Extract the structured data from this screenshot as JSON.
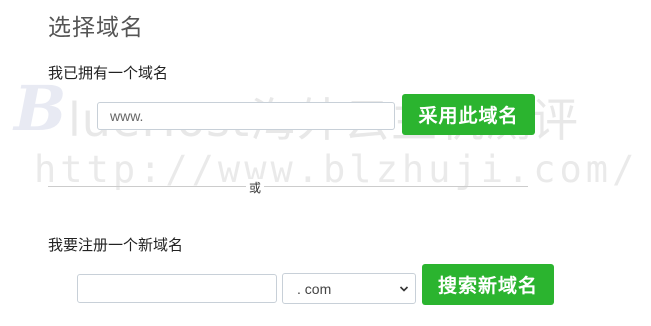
{
  "page": {
    "title": "选择域名"
  },
  "existing_domain": {
    "label": "我已拥有一个域名",
    "input_placeholder": "www.",
    "input_value": "",
    "button_label": "采用此域名"
  },
  "divider": {
    "or_text": "或"
  },
  "new_domain": {
    "label": "我要注册一个新域名",
    "input_placeholder": "",
    "input_value": "",
    "tld_selected": ". com",
    "tld_options": [
      ". com"
    ],
    "button_label": "搜索新域名"
  },
  "watermark": {
    "logo_letter": "B",
    "brand_text": "lueHost海外云主机测评",
    "url_text": "http://www.blzhuji.com/"
  },
  "colors": {
    "button_green": "#2bb42f",
    "button_text": "#ffffff",
    "input_border": "#c8d0d8",
    "title_gray": "#555555"
  },
  "icons": {
    "select_arrow": "chevron-down-icon"
  }
}
